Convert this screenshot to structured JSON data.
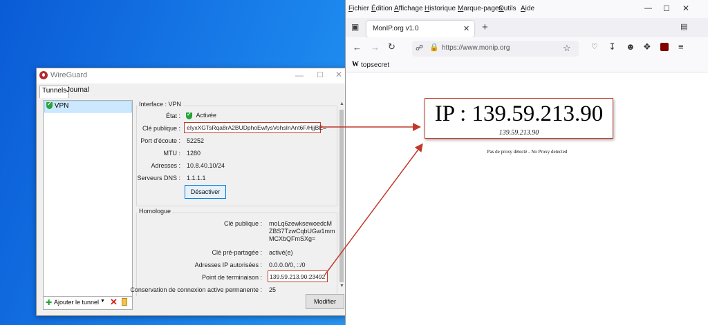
{
  "wireguard": {
    "title": "WireGuard",
    "tabs": [
      "Tunnels",
      "Journal"
    ],
    "tunnels": [
      {
        "name": "VPN"
      }
    ],
    "interface": {
      "group_title": "Interface : VPN",
      "status_label": "État :",
      "status_value": "Activée",
      "pubkey_label": "Clé publique :",
      "pubkey_value": "eIyxXGTsRqa8rA2BUDphoEwfysVohsInAnt6F/HjjBE=",
      "port_label": "Port d'écoute :",
      "port_value": "52252",
      "mtu_label": "MTU :",
      "mtu_value": "1280",
      "addr_label": "Adresses :",
      "addr_value": "10.8.40.10/24",
      "dns_label": "Serveurs DNS :",
      "dns_value": "1.1.1.1",
      "deactivate_label": "Désactiver"
    },
    "peer": {
      "group_title": "Homologue",
      "pubkey_label": "Clé publique :",
      "pubkey_lines": [
        "moLq6zewksewoedcM",
        "ZBS7TzwCqbUGw1mm",
        "MCXbQFmSXg="
      ],
      "psk_label": "Clé pré-partagée :",
      "psk_value": "activé(e)",
      "allowed_label": "Adresses IP autorisées :",
      "allowed_value": "0.0.0.0/0, ::/0",
      "endpoint_label": "Point de terminaison :",
      "endpoint_value": "139.59.213.90:23492",
      "keepalive_label": "Conservation de connexion active permanente :",
      "keepalive_value": "25"
    },
    "add_tunnel_label": "Ajouter le tunnel",
    "edit_label": "Modifier"
  },
  "firefox": {
    "menu": [
      {
        "pre": "",
        "u": "F",
        "post": "ichier"
      },
      {
        "pre": "",
        "u": "É",
        "post": "dition"
      },
      {
        "pre": "",
        "u": "A",
        "post": "ffichage"
      },
      {
        "pre": "",
        "u": "H",
        "post": "istorique"
      },
      {
        "pre": "",
        "u": "M",
        "post": "arque-pages"
      },
      {
        "pre": "",
        "u": "O",
        "post": "utils"
      },
      {
        "pre": "",
        "u": "A",
        "post": "ide"
      }
    ],
    "tab_title": "MonIP.org v1.0",
    "url": "https://www.monip.org",
    "bookmark": "topsecret",
    "page": {
      "ip_heading": "IP : 139.59.213.90",
      "ip_sub": "139.59.213.90",
      "proxy_text": "Pas de proxy détecté - No Proxy detected"
    }
  },
  "colors": {
    "highlight": "#c0392b",
    "shield_green": "#27a33a",
    "selection": "#cce8ff"
  }
}
